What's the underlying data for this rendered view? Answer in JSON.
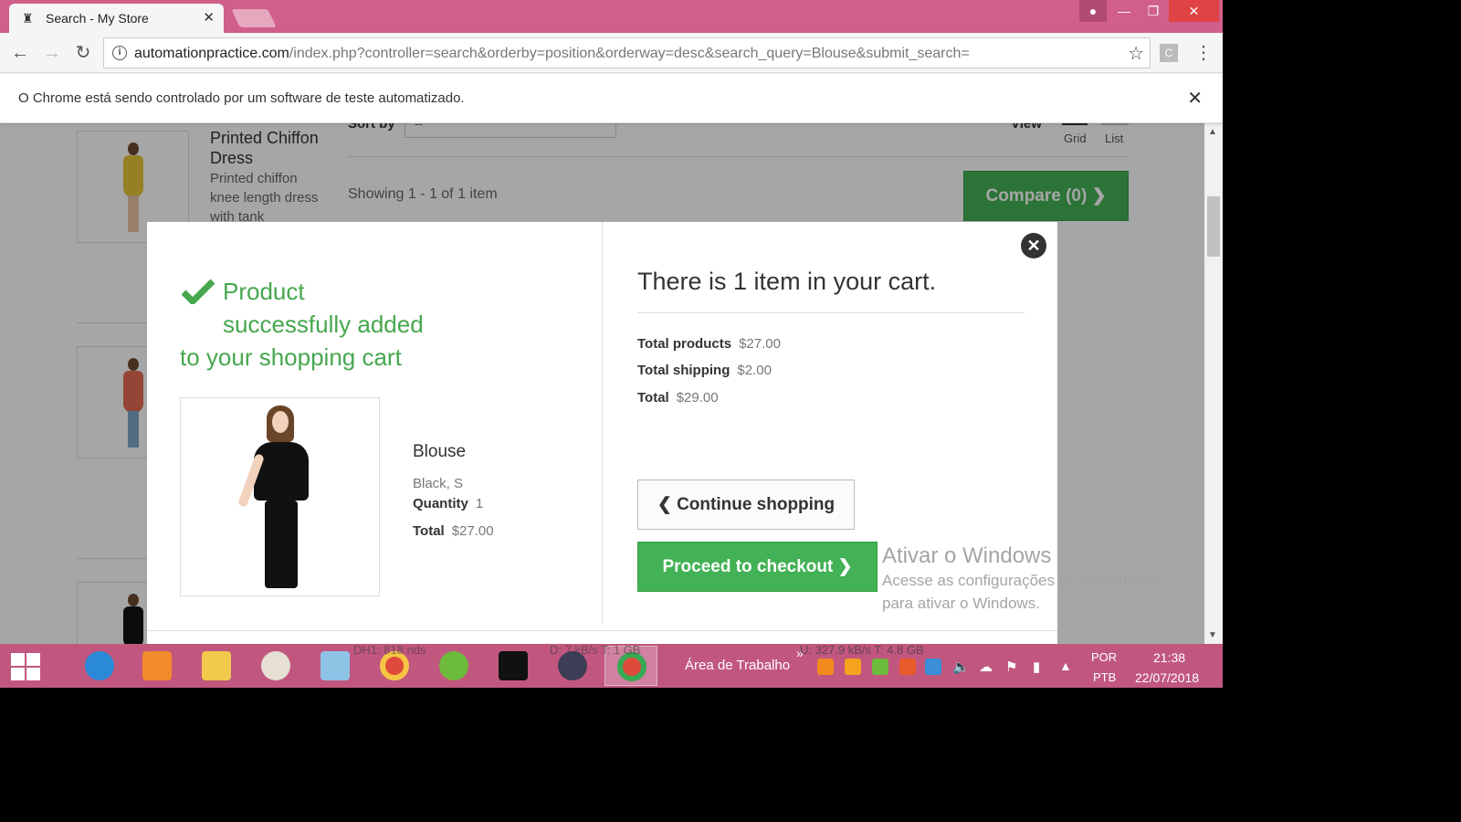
{
  "browser": {
    "tab_title": "Search - My Store",
    "url_host": "automationpractice.com",
    "url_path": "/index.php?controller=search&orderby=position&orderway=desc&search_query=Blouse&submit_search=",
    "ext_letter": "C",
    "infobar_message": "O Chrome está sendo controlado por um software de teste automatizado."
  },
  "page": {
    "product1_title": "Printed Chiffon Dress",
    "product1_desc": "Printed chiffon knee length dress with tank",
    "sort_label": "Sort by",
    "sort_value": "--",
    "view_label": "View",
    "grid_label": "Grid",
    "list_label": "List",
    "showing": "Showing 1 - 1 of 1 item",
    "compare_label": "Compare (0)"
  },
  "modal": {
    "success_line1": "Product",
    "success_line2": "successfully added",
    "success_line3": "to your shopping cart",
    "product_name": "Blouse",
    "product_attributes": "Black, S",
    "quantity_label": "Quantity",
    "quantity_value": "1",
    "total_label": "Total",
    "total_value": "$27.00",
    "cart_heading": "There is 1 item in your cart.",
    "total_products_label": "Total products",
    "total_products_value": "$27.00",
    "total_shipping_label": "Total shipping",
    "total_shipping_value": "$2.00",
    "grand_total_label": "Total",
    "grand_total_value": "$29.00",
    "continue_label": "Continue shopping",
    "checkout_label": "Proceed to checkout"
  },
  "watermark": {
    "title": "Ativar o Windows",
    "subtitle": "Acesse as configurações do computador para ativar o Windows."
  },
  "taskbar": {
    "desktop_label": "Área de Trabalho",
    "lang_top": "POR",
    "lang_bottom": "PTB",
    "time": "21:38",
    "date": "22/07/2018",
    "stats_left": "DH1: 818 nds",
    "stats_mid": "D: 7 kB/s T: 1 GB",
    "stats_right": "U: 327.9 kB/s T: 4.8 GB"
  },
  "colors": {
    "accent_green": "#43b155",
    "success_text": "#46a74e",
    "titlebar": "#d05f8a",
    "taskbar": "#c1577f"
  }
}
